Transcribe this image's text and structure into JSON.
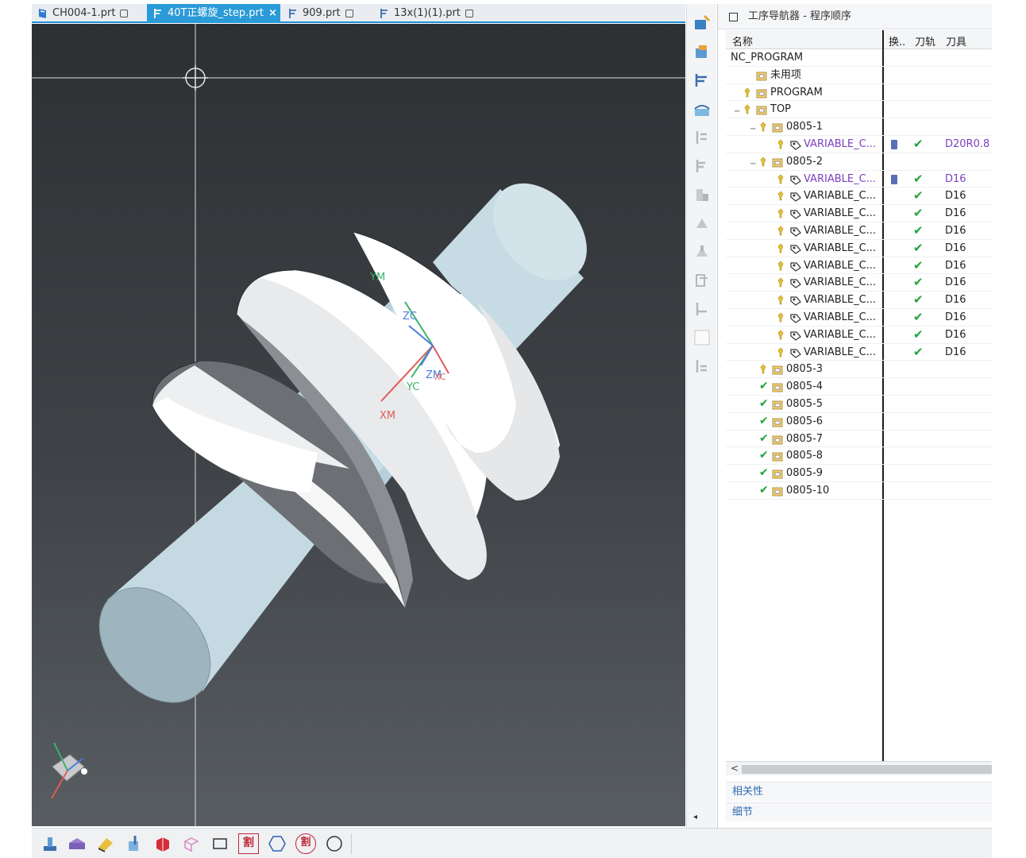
{
  "tabs": [
    {
      "label": "CH004-1.prt",
      "active": false
    },
    {
      "label": "40T正螺旋_step.prt",
      "active": true
    },
    {
      "label": "909.prt",
      "active": false
    },
    {
      "label": "13x(1)(1).prt",
      "active": false
    }
  ],
  "tab_close": "×",
  "viewport": {
    "axis_labels": {
      "ym": "YM",
      "zc": "ZC",
      "zm": "ZM",
      "xc": "XC",
      "yc": "YC",
      "xm": "XM"
    }
  },
  "navigator": {
    "title": "工序导航器 - 程序顺序",
    "columns": {
      "name": "名称",
      "swap": "换..",
      "path": "刀轨",
      "tool": "刀具"
    },
    "rows": [
      {
        "label": "NC_PROGRAM",
        "level": 0,
        "type": "root",
        "check": "",
        "tool": ""
      },
      {
        "label": "未用项",
        "level": 1,
        "type": "folder",
        "check": "",
        "tool": ""
      },
      {
        "label": "PROGRAM",
        "level": 1,
        "type": "program",
        "check": "",
        "tool": ""
      },
      {
        "label": "TOP",
        "level": 1,
        "type": "program",
        "check": "",
        "tool": "",
        "expander": "−"
      },
      {
        "label": "0805-1",
        "level": 2,
        "type": "program",
        "check": "",
        "tool": "",
        "expander": "−"
      },
      {
        "label": "VARIABLE_C...",
        "level": 3,
        "type": "op",
        "purple": true,
        "swap": true,
        "check": "✔",
        "tool": "D20R0.8"
      },
      {
        "label": "0805-2",
        "level": 2,
        "type": "program",
        "check": "",
        "tool": "",
        "expander": "−"
      },
      {
        "label": "VARIABLE_C...",
        "level": 3,
        "type": "op",
        "purple": true,
        "swap": true,
        "check": "✔",
        "tool": "D16"
      },
      {
        "label": "VARIABLE_C...",
        "level": 3,
        "type": "op",
        "check": "✔",
        "tool": "D16"
      },
      {
        "label": "VARIABLE_C...",
        "level": 3,
        "type": "op",
        "check": "✔",
        "tool": "D16"
      },
      {
        "label": "VARIABLE_C...",
        "level": 3,
        "type": "op",
        "check": "✔",
        "tool": "D16"
      },
      {
        "label": "VARIABLE_C...",
        "level": 3,
        "type": "op",
        "check": "✔",
        "tool": "D16"
      },
      {
        "label": "VARIABLE_C...",
        "level": 3,
        "type": "op",
        "check": "✔",
        "tool": "D16"
      },
      {
        "label": "VARIABLE_C...",
        "level": 3,
        "type": "op",
        "check": "✔",
        "tool": "D16"
      },
      {
        "label": "VARIABLE_C...",
        "level": 3,
        "type": "op",
        "check": "✔",
        "tool": "D16"
      },
      {
        "label": "VARIABLE_C...",
        "level": 3,
        "type": "op",
        "check": "✔",
        "tool": "D16"
      },
      {
        "label": "VARIABLE_C...",
        "level": 3,
        "type": "op",
        "check": "✔",
        "tool": "D16"
      },
      {
        "label": "VARIABLE_C...",
        "level": 3,
        "type": "op",
        "check": "✔",
        "tool": "D16"
      },
      {
        "label": "0805-3",
        "level": 2,
        "type": "program",
        "check": "",
        "tool": ""
      },
      {
        "label": "0805-4",
        "level": 2,
        "type": "program-done",
        "check": "",
        "tool": ""
      },
      {
        "label": "0805-5",
        "level": 2,
        "type": "program-done",
        "check": "",
        "tool": ""
      },
      {
        "label": "0805-6",
        "level": 2,
        "type": "program-done",
        "check": "",
        "tool": ""
      },
      {
        "label": "0805-7",
        "level": 2,
        "type": "program-done",
        "check": "",
        "tool": ""
      },
      {
        "label": "0805-8",
        "level": 2,
        "type": "program-done",
        "check": "",
        "tool": ""
      },
      {
        "label": "0805-9",
        "level": 2,
        "type": "program-done",
        "check": "",
        "tool": ""
      },
      {
        "label": "0805-10",
        "level": 2,
        "type": "program-done",
        "check": "",
        "tool": ""
      }
    ],
    "sections": {
      "dependencies": "相关性",
      "details": "细节"
    }
  },
  "bottom_toolbar": {
    "icons": [
      "create-program-icon",
      "create-tool-icon",
      "create-geometry-icon",
      "create-method-icon",
      "create-operation-icon",
      "workpiece-icon",
      "rectangle-icon",
      "cut-region-icon",
      "hexagon-icon",
      "cut-region-round-icon",
      "circle-icon"
    ],
    "labels": {
      "cut": "割"
    }
  },
  "colors": {
    "accent": "#2b9ad8",
    "check": "#22a33a",
    "purple_op": "#7b3fbf",
    "cylinder": "#c9dde6",
    "flange": "#f2f3f4"
  }
}
